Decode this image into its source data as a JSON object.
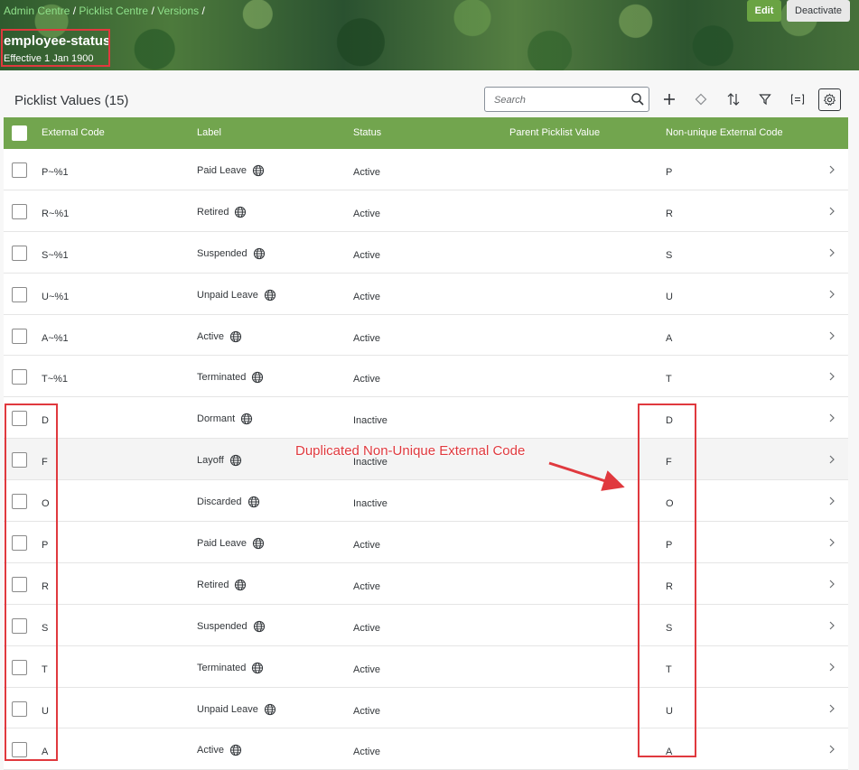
{
  "breadcrumb": {
    "items": [
      "Admin Centre",
      "Picklist Centre",
      "Versions"
    ],
    "separator": "/"
  },
  "header": {
    "title": "employee-status",
    "effective": "Effective 1 Jan 1900",
    "edit_label": "Edit",
    "deactivate_label": "Deactivate"
  },
  "toolbar": {
    "list_title": "Picklist Values (15)",
    "search_placeholder": "Search",
    "icons": [
      "add-icon",
      "diamond-icon",
      "sort-icon",
      "filter-icon",
      "group-icon",
      "settings-icon"
    ]
  },
  "table": {
    "columns": [
      "External Code",
      "Label",
      "Status",
      "Parent Picklist Value",
      "Non-unique External Code"
    ],
    "rows": [
      {
        "code": "P~%1",
        "label": "Paid Leave",
        "status": "Active",
        "parent": "",
        "nonunique": "P"
      },
      {
        "code": "R~%1",
        "label": "Retired",
        "status": "Active",
        "parent": "",
        "nonunique": "R"
      },
      {
        "code": "S~%1",
        "label": "Suspended",
        "status": "Active",
        "parent": "",
        "nonunique": "S"
      },
      {
        "code": "U~%1",
        "label": "Unpaid Leave",
        "status": "Active",
        "parent": "",
        "nonunique": "U"
      },
      {
        "code": "A~%1",
        "label": "Active",
        "status": "Active",
        "parent": "",
        "nonunique": "A"
      },
      {
        "code": "T~%1",
        "label": "Terminated",
        "status": "Active",
        "parent": "",
        "nonunique": "T"
      },
      {
        "code": "D",
        "label": "Dormant",
        "status": "Inactive",
        "parent": "",
        "nonunique": "D"
      },
      {
        "code": "F",
        "label": "Layoff",
        "status": "Inactive",
        "parent": "",
        "nonunique": "F"
      },
      {
        "code": "O",
        "label": "Discarded",
        "status": "Inactive",
        "parent": "",
        "nonunique": "O"
      },
      {
        "code": "P",
        "label": "Paid Leave",
        "status": "Active",
        "parent": "",
        "nonunique": "P"
      },
      {
        "code": "R",
        "label": "Retired",
        "status": "Active",
        "parent": "",
        "nonunique": "R"
      },
      {
        "code": "S",
        "label": "Suspended",
        "status": "Active",
        "parent": "",
        "nonunique": "S"
      },
      {
        "code": "T",
        "label": "Terminated",
        "status": "Active",
        "parent": "",
        "nonunique": "T"
      },
      {
        "code": "U",
        "label": "Unpaid Leave",
        "status": "Active",
        "parent": "",
        "nonunique": "U"
      },
      {
        "code": "A",
        "label": "Active",
        "status": "Active",
        "parent": "",
        "nonunique": "A"
      }
    ]
  },
  "annotation": {
    "text": "Duplicated Non-Unique External Code"
  },
  "colors": {
    "accent": "#72a54e",
    "link": "#8fe08a",
    "annotation": "#e0393e"
  }
}
